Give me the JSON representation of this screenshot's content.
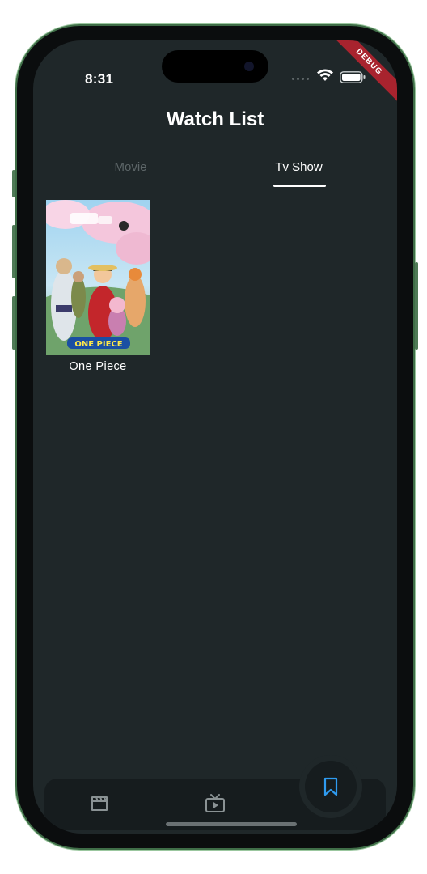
{
  "status_bar": {
    "time": "8:31",
    "debug_banner": "DEBUG"
  },
  "header": {
    "title": "Watch List"
  },
  "tabs": [
    {
      "label": "Movie",
      "selected": false
    },
    {
      "label": "Tv Show",
      "selected": true
    }
  ],
  "watchlist": [
    {
      "title": "One Piece",
      "poster_logo": "ONE PIECE"
    }
  ],
  "bottom_nav": {
    "items": [
      {
        "icon": "clapperboard-icon",
        "active": false
      },
      {
        "icon": "tv-play-icon",
        "active": false
      },
      {
        "icon": "bookmark-icon",
        "active": true
      }
    ],
    "active_color": "#2f9bf0",
    "inactive_color": "#8a9294"
  },
  "colors": {
    "background": "#1f2729",
    "nav_background": "#161c1e",
    "accent": "#2f9bf0",
    "debug": "#a8232e"
  }
}
